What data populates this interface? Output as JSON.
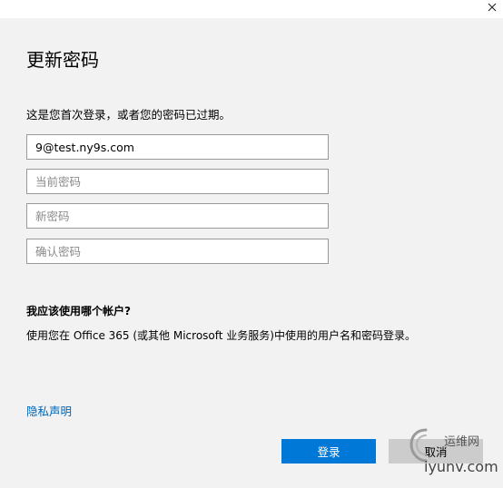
{
  "dialog": {
    "title": "更新密码",
    "intro": "这是您首次登录，或者您的密码已过期。"
  },
  "fields": {
    "account_value": "9@test.ny9s.com",
    "current_password_placeholder": "当前密码",
    "new_password_placeholder": "新密码",
    "confirm_password_placeholder": "确认密码"
  },
  "help": {
    "question": "我应该使用哪个帐户?",
    "answer": "使用您在 Office 365 (或其他 Microsoft 业务服务)中使用的用户名和密码登录。"
  },
  "links": {
    "privacy": "隐私声明"
  },
  "buttons": {
    "sign_in": "登录",
    "cancel": "取消"
  },
  "watermark": {
    "cn": "运维网",
    "domain": "iyunv.com"
  },
  "colors": {
    "accent": "#0078d7",
    "link": "#0067b8",
    "dialog_bg": "#f2f2f2"
  },
  "icons": {
    "close": "close-icon"
  }
}
